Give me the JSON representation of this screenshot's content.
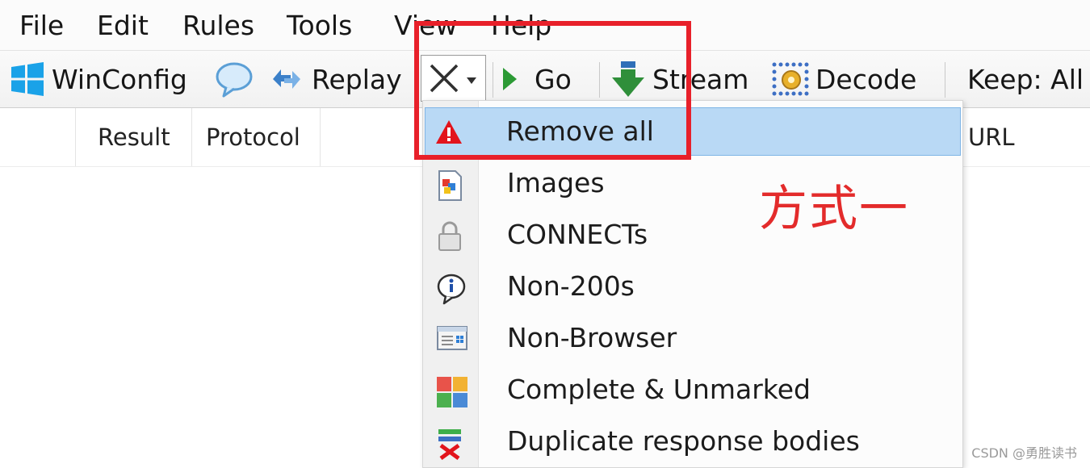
{
  "menubar": {
    "items": [
      "File",
      "Edit",
      "Rules",
      "Tools",
      "View",
      "Help"
    ]
  },
  "toolbar": {
    "winconfig_label": "WinConfig",
    "replay_label": "Replay",
    "go_label": "Go",
    "stream_label": "Stream",
    "decode_label": "Decode",
    "keep_label": "Keep: All"
  },
  "grid": {
    "columns": [
      "Result",
      "Protocol",
      "URL"
    ]
  },
  "remove_menu": {
    "items": [
      {
        "label": "Remove all",
        "icon": "warning-icon"
      },
      {
        "label": "Images",
        "icon": "image-icon"
      },
      {
        "label": "CONNECTs",
        "icon": "lock-icon"
      },
      {
        "label": "Non-200s",
        "icon": "info-icon"
      },
      {
        "label": "Non-Browser",
        "icon": "window-icon"
      },
      {
        "label": "Complete & Unmarked",
        "icon": "tiles-icon"
      },
      {
        "label": "Duplicate response bodies",
        "icon": "duplicate-remove-icon"
      }
    ]
  },
  "annotation": {
    "text": "方式一",
    "color": "#e32b2b"
  },
  "watermark": "CSDN @勇胜读书"
}
